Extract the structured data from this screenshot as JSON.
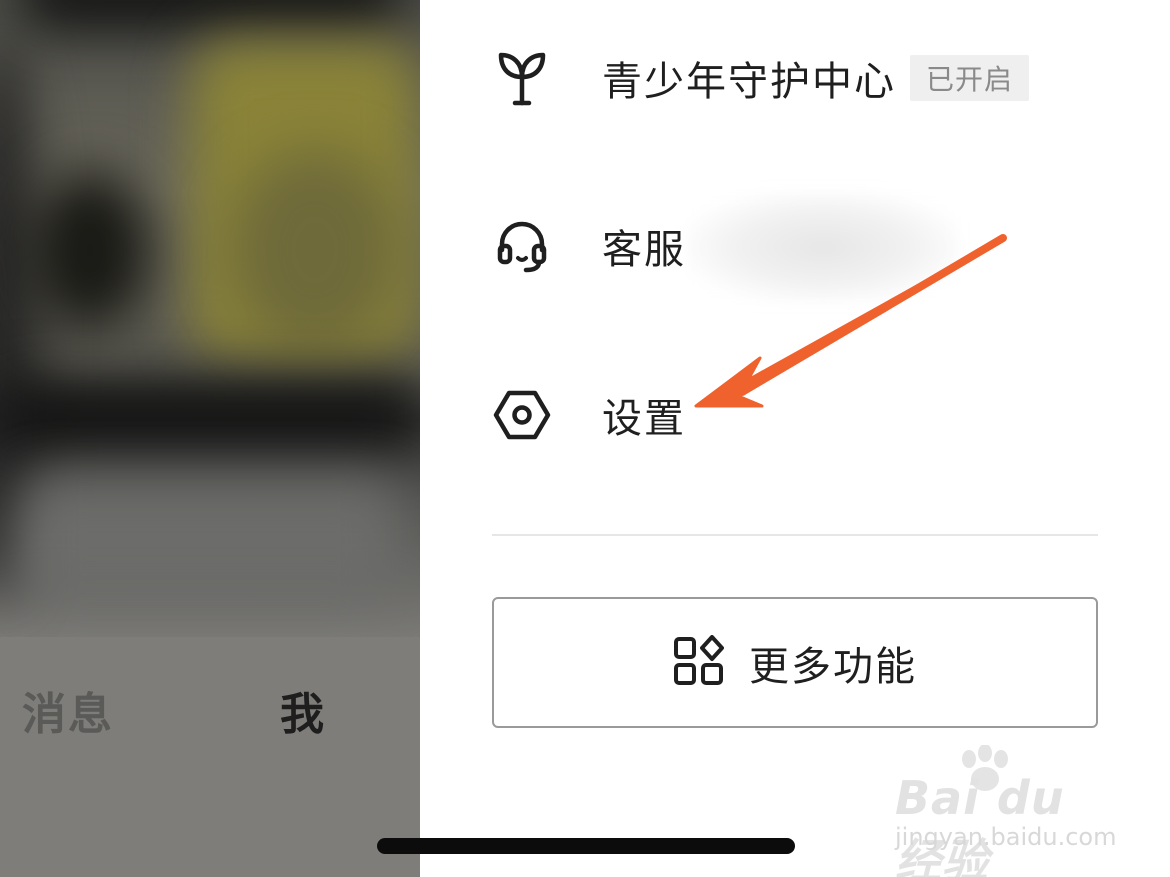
{
  "background": {
    "tabs": [
      {
        "label": "消息"
      },
      {
        "label": "我"
      }
    ]
  },
  "menu": {
    "items": [
      {
        "label": "青少年守护中心",
        "badge": "已开启",
        "icon": "sprout-icon"
      },
      {
        "label": "客服",
        "icon": "headset-icon"
      },
      {
        "label": "设置",
        "icon": "hexagon-settings-icon"
      }
    ],
    "more_button": {
      "label": "更多功能",
      "icon": "grid-apps-icon"
    }
  },
  "annotation": {
    "arrow_color": "#f0622d"
  },
  "watermark": {
    "brand": "Bai du 经验",
    "url": "jingyan.baidu.com"
  },
  "colors": {
    "text": "#1f1f1f",
    "badge_bg": "#efefef",
    "badge_text": "#8a8a8a"
  }
}
